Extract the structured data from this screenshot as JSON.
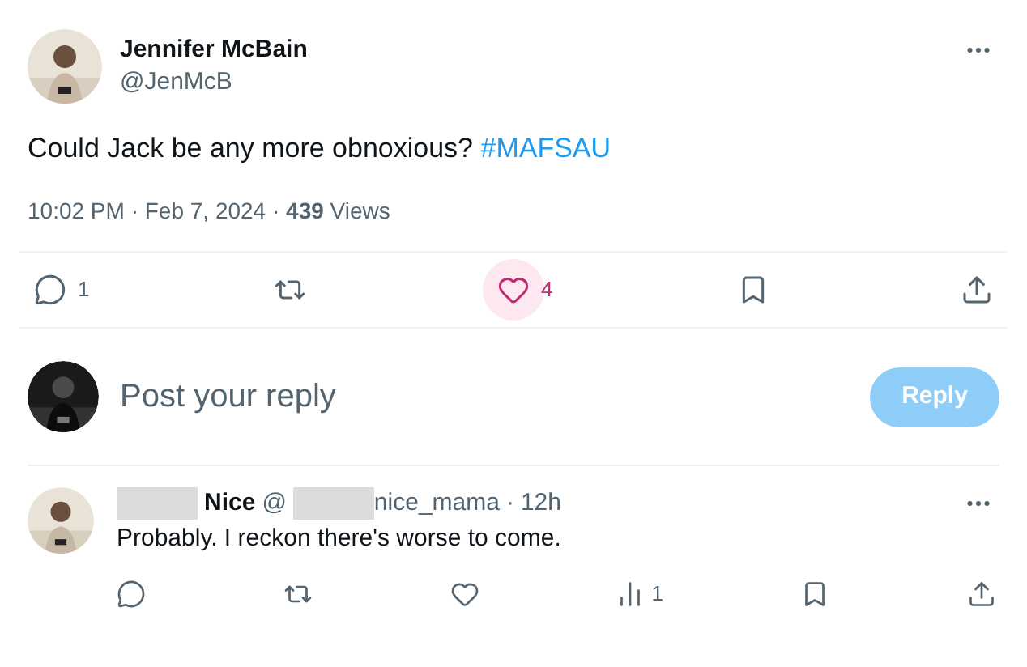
{
  "tweet": {
    "name": "Jennifer McBain",
    "handle": "@JenMcB",
    "text": "Could Jack be any more obnoxious?",
    "hashtag": "#MAFSAU",
    "meta": "10:02 PM · Feb 7, 2024 · **439** Views",
    "actions": [
      {
        "kind": "reply",
        "count": "1",
        "highlighted": false
      },
      {
        "kind": "repost",
        "highlighted": false
      },
      {
        "kind": "like",
        "count": "4",
        "highlighted": true
      },
      {
        "kind": "bookmark",
        "highlighted": false
      },
      {
        "kind": "share",
        "highlighted": false
      }
    ]
  },
  "composer": {
    "placeholder": "Post your reply",
    "button": {
      "label": "Reply",
      "disabled": true
    }
  },
  "reply": {
    "name_redacted": true,
    "name": "Nice",
    "handle_prefix": "@",
    "handle_redacted": true,
    "handle": "nice_mama",
    "separator": "·",
    "time": "12h",
    "text": "Probably. I reckon there's worse to come.",
    "actions": [
      {
        "kind": "reply"
      },
      {
        "kind": "repost"
      },
      {
        "kind": "like"
      },
      {
        "kind": "views",
        "count": "1"
      },
      {
        "kind": "bookmark"
      },
      {
        "kind": "share"
      }
    ]
  }
}
